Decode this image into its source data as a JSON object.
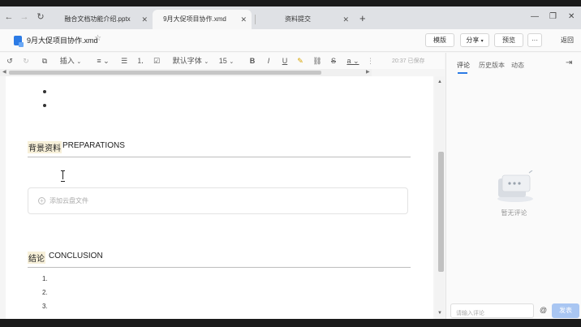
{
  "browser": {
    "tabs": [
      {
        "label": "融合文档功能介绍.pptx",
        "close": "✕"
      },
      {
        "label": "9月大促项目协作.xmd",
        "close": "✕"
      },
      {
        "label": "资料提交",
        "close": "✕"
      }
    ],
    "new_tab": "+",
    "nav_icons": {
      "back": "back-arrow-icon",
      "forward": "forward-arrow-icon",
      "reload": "reload-icon"
    }
  },
  "header": {
    "doc_title": "9月大促项目协作.xmd",
    "buttons": {
      "template": "模版",
      "share": "分享",
      "preview": "预览",
      "more": "···"
    },
    "back": "返回"
  },
  "toolbar": {
    "insert": "插入",
    "font_family": "默认字体",
    "font_size": "15",
    "saved_status": "20:37 已保存"
  },
  "document": {
    "section1": {
      "cn": "背景资料",
      "en": "PREPARATIONS"
    },
    "add_cloud_file": "添加云盘文件",
    "section2": {
      "cn": "结论",
      "en": "CONCLUSION"
    },
    "numbered": [
      "1.",
      "2.",
      "3."
    ]
  },
  "panel": {
    "tabs": [
      "评论",
      "历史版本",
      "动态"
    ],
    "empty_text": "暂无评论",
    "comment_placeholder": "请输入评论",
    "at": "@",
    "send": "发表"
  },
  "colors": {
    "accent": "#2c7be5",
    "send_disabled": "#a9c6f2",
    "heading_highlight": "#f7f0d9"
  }
}
